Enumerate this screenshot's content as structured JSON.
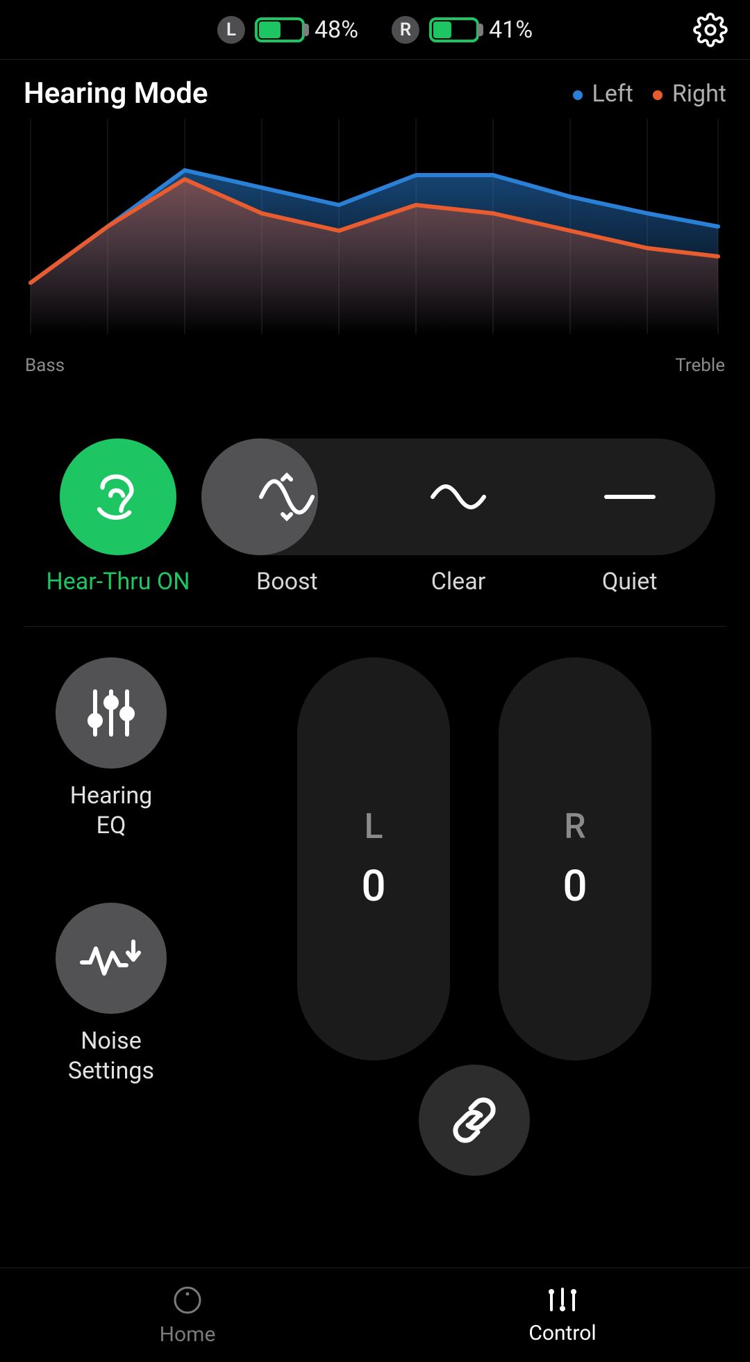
{
  "status": {
    "left_badge": "L",
    "left_pct_text": "48%",
    "left_pct": 48,
    "right_badge": "R",
    "right_pct_text": "41%",
    "right_pct": 41,
    "settings_icon": "gear-icon"
  },
  "hearing": {
    "title": "Hearing Mode",
    "legend_left": "Left",
    "legend_right": "Right",
    "x_low": "Bass",
    "x_high": "Treble"
  },
  "modes": {
    "hear_thru_icon": "ear-swirl-icon",
    "hear_thru_label": "Hear-Thru ON",
    "boost_icon": "wave-boost-icon",
    "boost_label": "Boost",
    "clear_icon": "wave-icon",
    "clear_label": "Clear",
    "quiet_icon": "line-icon",
    "quiet_label": "Quiet",
    "selected": "boost"
  },
  "actions": {
    "eq_icon": "sliders-icon",
    "eq_label": "Hearing\nEQ",
    "noise_icon": "noise-down-icon",
    "noise_label": "Noise\nSettings"
  },
  "volume": {
    "left_letter": "L",
    "left_value": "0",
    "right_letter": "R",
    "right_value": "0",
    "link_icon": "link-icon"
  },
  "nav": {
    "home_icon": "circle-dot-icon",
    "home_label": "Home",
    "control_icon": "equalizer-bars-icon",
    "control_label": "Control"
  },
  "colors": {
    "accent_green": "#1ec663",
    "left_series": "#2a7fd6",
    "right_series": "#e85c2f"
  },
  "chart_data": {
    "type": "area",
    "x": [
      0,
      1,
      2,
      3,
      4,
      5,
      6,
      7,
      8,
      9
    ],
    "xlabel_low": "Bass",
    "xlabel_high": "Treble",
    "ylim": [
      0,
      100
    ],
    "series": [
      {
        "name": "Left",
        "color": "#2a7fd6",
        "values": [
          24,
          50,
          76,
          68,
          60,
          74,
          74,
          64,
          56,
          50
        ]
      },
      {
        "name": "Right",
        "color": "#e85c2f",
        "values": [
          24,
          50,
          72,
          56,
          48,
          60,
          56,
          48,
          40,
          36
        ]
      }
    ]
  }
}
